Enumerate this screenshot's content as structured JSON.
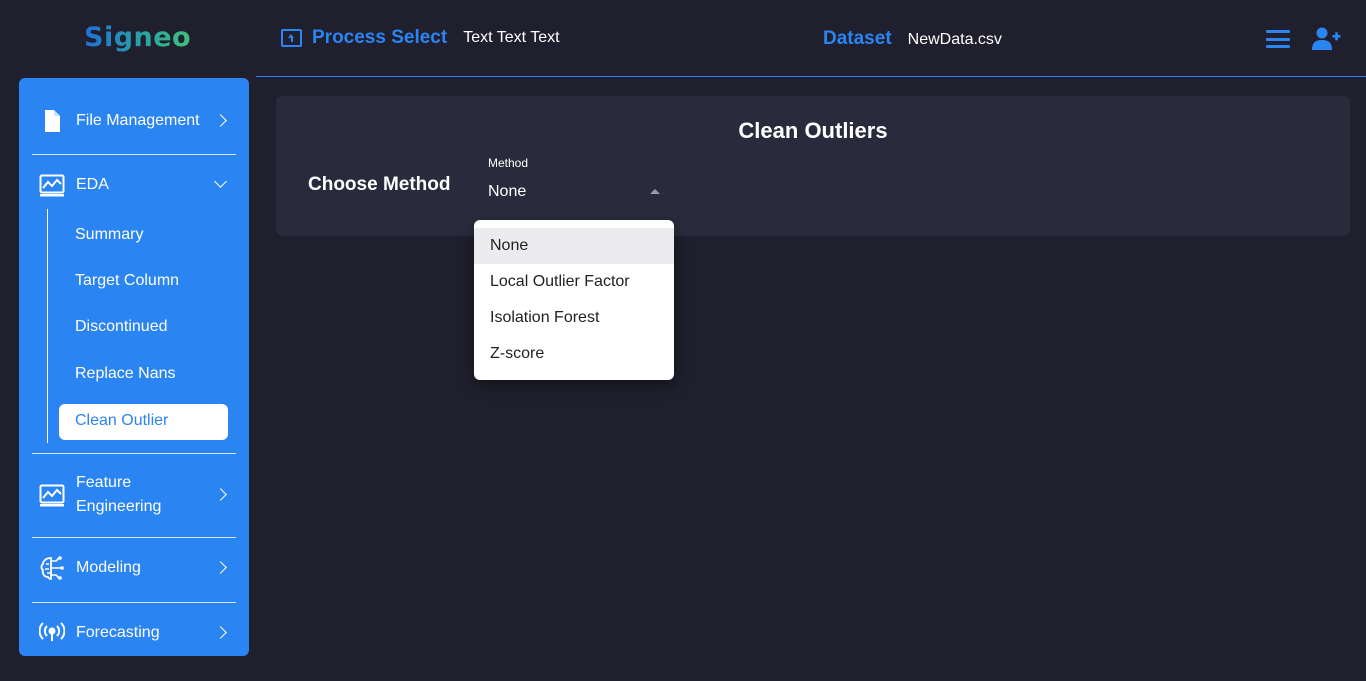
{
  "logo": {
    "text": "Signeo"
  },
  "header": {
    "process_title": "Process Select",
    "process_value": "Text Text Text",
    "dataset_title": "Dataset",
    "dataset_value": "NewData.csv",
    "icons": [
      "upload-icon",
      "menu-icon",
      "user-add-icon"
    ],
    "accent_color": "#2a84f2"
  },
  "sidebar": {
    "items": [
      {
        "label": "File Management",
        "icon": "file-icon",
        "expanded": false
      },
      {
        "label": "EDA",
        "icon": "chart-icon",
        "expanded": true,
        "children": [
          {
            "label": "Summary"
          },
          {
            "label": "Target Column"
          },
          {
            "label": "Discontinued"
          },
          {
            "label": "Replace Nans"
          },
          {
            "label": "Clean Outlier",
            "active": true
          }
        ]
      },
      {
        "label": "Feature Engineering",
        "icon": "chart-icon",
        "expanded": false
      },
      {
        "label": "Modeling",
        "icon": "brain-icon",
        "expanded": false
      },
      {
        "label": "Forecasting",
        "icon": "broadcast-icon",
        "expanded": false
      }
    ]
  },
  "main": {
    "title": "Clean Outliers",
    "choose_label": "Choose Method",
    "select": {
      "caption": "Method",
      "value": "None",
      "options": [
        "None",
        "Local Outlier Factor",
        "Isolation Forest",
        "Z-score"
      ],
      "selected_index": 0
    }
  }
}
